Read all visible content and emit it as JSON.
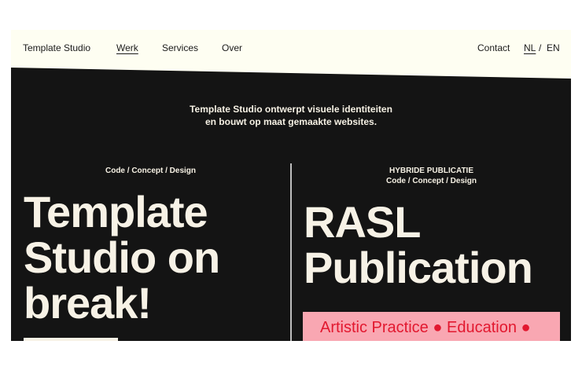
{
  "nav": {
    "brand": "Template Studio",
    "items": [
      {
        "label": "Werk"
      },
      {
        "label": "Services"
      },
      {
        "label": "Over"
      }
    ],
    "contact": "Contact",
    "lang_nl": "NL",
    "lang_sep": "/",
    "lang_en": "EN"
  },
  "hero": {
    "intro_line1": "Template Studio ontwerpt visuele identiteiten",
    "intro_line2": "en bouwt op maat gemaakte websites."
  },
  "left_card": {
    "tag": "Code / Concept / Design",
    "title_line1": "Template",
    "title_line2": "Studio on",
    "title_line3": "break!"
  },
  "right_card": {
    "tag_line1": "HYBRIDE PUBLICATIE",
    "tag_line2": "Code / Concept / Design",
    "title_line1": "RASL",
    "title_line2": "Publication",
    "banner_text": "Artistic Practice ● Education ●"
  },
  "colors": {
    "background": "#141414",
    "nav_background": "#fefef2",
    "text_light": "#f6f1e4",
    "banner_background": "#f9a7b2",
    "banner_text": "#e2182f"
  }
}
